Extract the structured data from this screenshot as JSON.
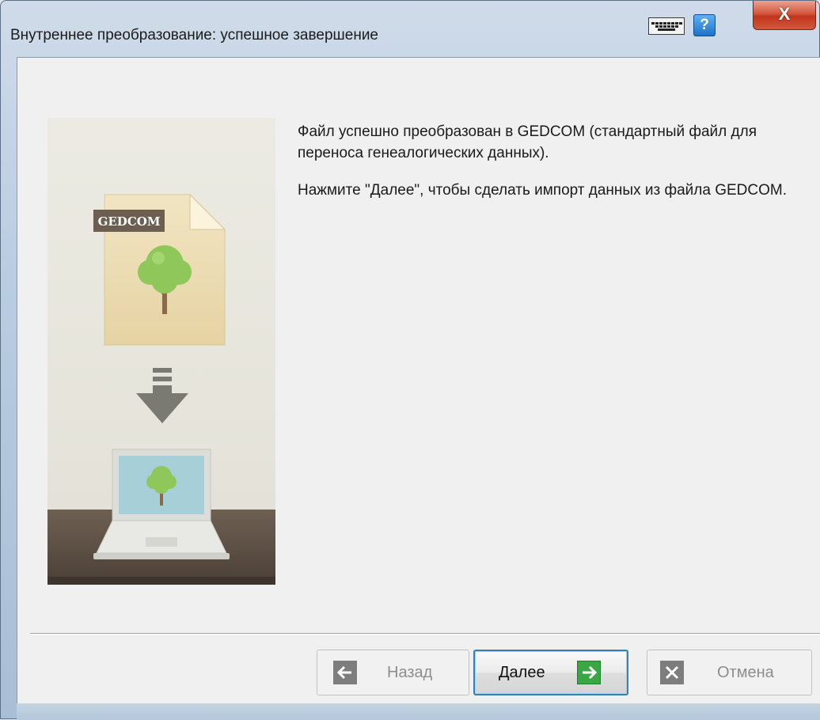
{
  "window": {
    "title": "Внутреннее преобразование: успешное завершение",
    "help_label": "?",
    "close_label": "X"
  },
  "illustration": {
    "file_badge": "GEDCOM"
  },
  "message": {
    "paragraph1": "Файл успешно преобразован в GEDCOM (стандартный файл для переноса генеалогических данных).",
    "paragraph2": "Нажмите \"Далее\", чтобы сделать импорт данных из файла GEDCOM."
  },
  "buttons": {
    "back": {
      "label": "Назад",
      "enabled": false,
      "icon": "arrow-left-icon"
    },
    "next": {
      "label": "Далее",
      "enabled": true,
      "default": true,
      "icon": "arrow-right-icon"
    },
    "cancel": {
      "label": "Отмена",
      "enabled": false,
      "icon": "x-icon"
    }
  },
  "colors": {
    "next_icon": "#38a744",
    "close_button": "#c2351c",
    "help_button": "#1d72c8"
  }
}
